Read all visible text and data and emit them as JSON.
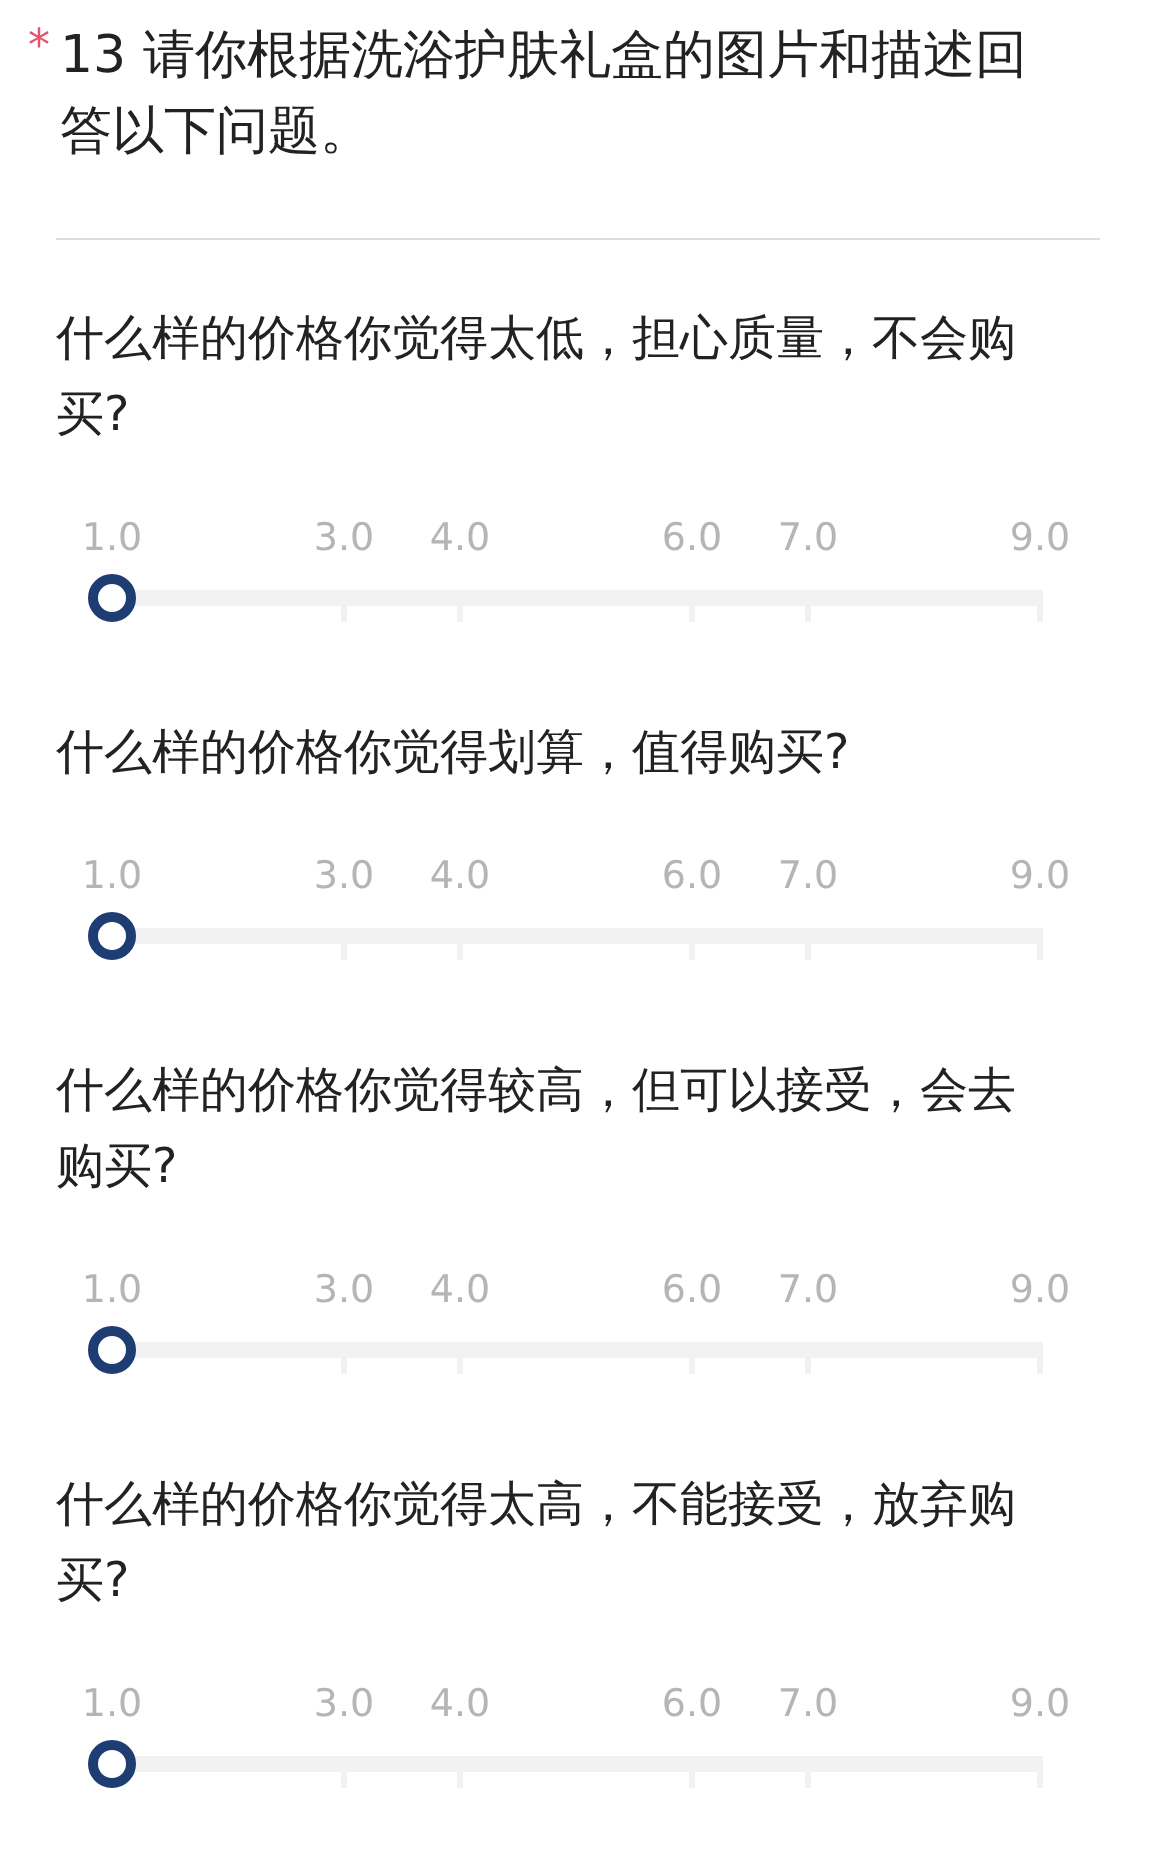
{
  "question": {
    "required_mark": "*",
    "title": "13 请你根据洗浴护肤礼盒的图片和描述回答以下问题。"
  },
  "sliders": [
    {
      "label": "什么样的价格你觉得太低，担心质量，不会购买?",
      "ticks": [
        "1.0",
        "3.0",
        "4.0",
        "6.0",
        "7.0",
        "9.0"
      ],
      "level": 0
    },
    {
      "label": "什么样的价格你觉得划算，值得购买?",
      "ticks": [
        "1.0",
        "3.0",
        "4.0",
        "6.0",
        "7.0",
        "9.0"
      ],
      "level": 0
    },
    {
      "label": "什么样的价格你觉得较高，但可以接受，会去购买?",
      "ticks": [
        "1.0",
        "3.0",
        "4.0",
        "6.0",
        "7.0",
        "9.0"
      ],
      "level": 0
    },
    {
      "label": "什么样的价格你觉得太高，不能接受，放弃购买?",
      "ticks": [
        "1.0",
        "3.0",
        "4.0",
        "6.0",
        "7.0",
        "9.0"
      ],
      "level": 0
    }
  ]
}
